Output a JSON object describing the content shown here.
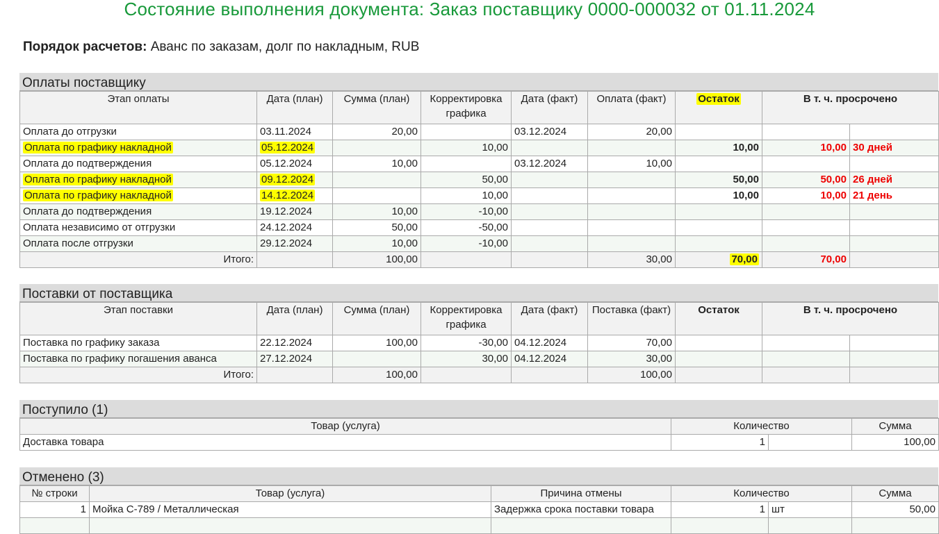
{
  "title": "Состояние выполнения документа: Заказ поставщику 0000-000032 от 01.11.2024",
  "terms": {
    "label": "Порядок расчетов:",
    "value": "Аванс по заказам, долг по накладным, RUB"
  },
  "payments": {
    "title": "Оплаты поставщику",
    "headers": [
      "Этап оплаты",
      "Дата (план)",
      "Сумма (план)",
      "Корректировка графика",
      "Дата (факт)",
      "Оплата (факт)",
      "Остаток",
      "В т. ч. просрочено"
    ],
    "rows": [
      {
        "stage": "Оплата до отгрузки",
        "date_plan": "03.11.2024",
        "sum_plan": "20,00",
        "adj": "",
        "date_fact": "03.12.2024",
        "paid": "20,00",
        "rest": "",
        "overdue": "",
        "days": "",
        "highlight": false
      },
      {
        "stage": "Оплата по графику накладной",
        "date_plan": "05.12.2024",
        "sum_plan": "",
        "adj": "10,00",
        "date_fact": "",
        "paid": "",
        "rest": "10,00",
        "overdue": "10,00",
        "days": "30 дней",
        "highlight": true
      },
      {
        "stage": "Оплата до подтверждения",
        "date_plan": "05.12.2024",
        "sum_plan": "10,00",
        "adj": "",
        "date_fact": "03.12.2024",
        "paid": "10,00",
        "rest": "",
        "overdue": "",
        "days": "",
        "highlight": false
      },
      {
        "stage": "Оплата по графику накладной",
        "date_plan": "09.12.2024",
        "sum_plan": "",
        "adj": "50,00",
        "date_fact": "",
        "paid": "",
        "rest": "50,00",
        "overdue": "50,00",
        "days": "26 дней",
        "highlight": true
      },
      {
        "stage": "Оплата по графику накладной",
        "date_plan": "14.12.2024",
        "sum_plan": "",
        "adj": "10,00",
        "date_fact": "",
        "paid": "",
        "rest": "10,00",
        "overdue": "10,00",
        "days": "21 день",
        "highlight": true
      },
      {
        "stage": "Оплата до подтверждения",
        "date_plan": "19.12.2024",
        "sum_plan": "10,00",
        "adj": "-10,00",
        "date_fact": "",
        "paid": "",
        "rest": "",
        "overdue": "",
        "days": "",
        "highlight": false
      },
      {
        "stage": "Оплата независимо от отгрузки",
        "date_plan": "24.12.2024",
        "sum_plan": "50,00",
        "adj": "-50,00",
        "date_fact": "",
        "paid": "",
        "rest": "",
        "overdue": "",
        "days": "",
        "highlight": false
      },
      {
        "stage": "Оплата после отгрузки",
        "date_plan": "29.12.2024",
        "sum_plan": "10,00",
        "adj": "-10,00",
        "date_fact": "",
        "paid": "",
        "rest": "",
        "overdue": "",
        "days": "",
        "highlight": false
      }
    ],
    "total": {
      "label": "Итого:",
      "sum_plan": "100,00",
      "paid": "30,00",
      "rest": "70,00",
      "overdue": "70,00"
    }
  },
  "deliveries": {
    "title": "Поставки от поставщика",
    "headers": [
      "Этап поставки",
      "Дата (план)",
      "Сумма (план)",
      "Корректировка графика",
      "Дата (факт)",
      "Поставка (факт)",
      "Остаток",
      "В т. ч. просрочено"
    ],
    "rows": [
      {
        "stage": "Поставка по графику заказа",
        "date_plan": "22.12.2024",
        "sum_plan": "100,00",
        "adj": "-30,00",
        "date_fact": "04.12.2024",
        "paid": "70,00",
        "rest": "",
        "overdue": "",
        "days": ""
      },
      {
        "stage": "Поставка по графику погашения аванса",
        "date_plan": "27.12.2024",
        "sum_plan": "",
        "adj": "30,00",
        "date_fact": "04.12.2024",
        "paid": "30,00",
        "rest": "",
        "overdue": "",
        "days": ""
      }
    ],
    "total": {
      "label": "Итого:",
      "sum_plan": "100,00",
      "paid": "100,00",
      "rest": "",
      "overdue": ""
    }
  },
  "received": {
    "title": "Поступило (1)",
    "headers": [
      "Товар (услуга)",
      "Количество",
      "Сумма"
    ],
    "rows": [
      {
        "item": "Доставка товара",
        "qty": "1",
        "unit": "",
        "sum": "100,00"
      }
    ]
  },
  "cancelled": {
    "title": "Отменено (3)",
    "headers": [
      "№ строки",
      "Товар (услуга)",
      "Причина отмены",
      "Количество",
      "Сумма"
    ],
    "rows": [
      {
        "n": "1",
        "item": "Мойка С-789 / Металлическая",
        "reason": "Задержка срока поставки товара",
        "qty": "1",
        "unit": "шт",
        "sum": "50,00"
      }
    ]
  }
}
